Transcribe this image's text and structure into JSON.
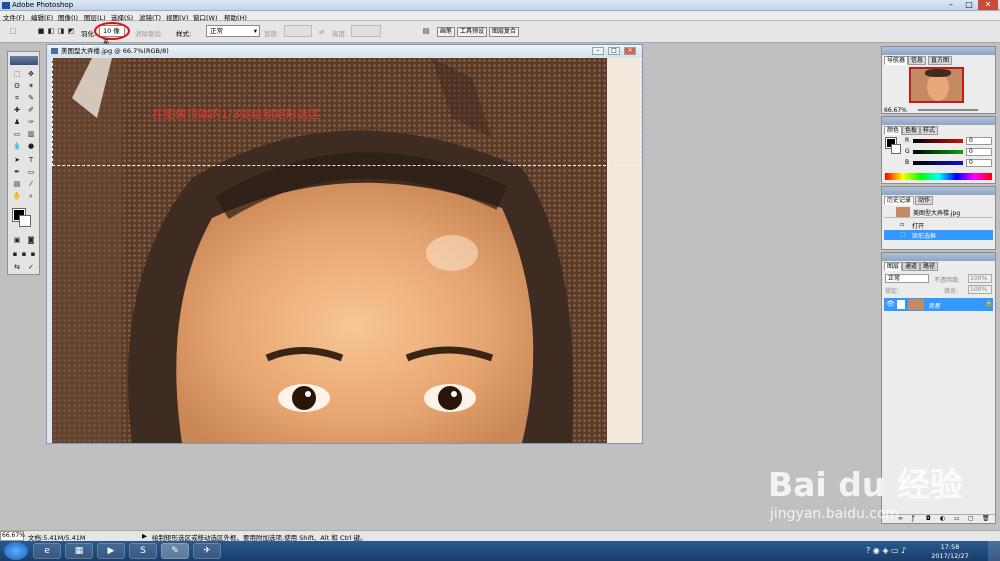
{
  "app": {
    "title": "Adobe Photoshop"
  },
  "menu": [
    "文件(F)",
    "编辑(E)",
    "图像(I)",
    "图层(L)",
    "选择(S)",
    "滤镜(T)",
    "视图(V)",
    "窗口(W)",
    "帮助(H)"
  ],
  "options": {
    "feather_label": "羽化:",
    "feather_value": "10 像素",
    "antialias_label": "消除锯齿",
    "style_label": "样式:",
    "style_value": "正常",
    "width_label": "宽度:",
    "height_label": "高度:"
  },
  "palette_well": [
    "画笔",
    "工具预设",
    "图层复合"
  ],
  "document": {
    "title": "美图型大弄楼.jpg @ 66.7%(RGB/8)",
    "annotation": "在图像顶端的1/3处绘制矩形选区"
  },
  "navigator": {
    "tabs": [
      "导航器",
      "信息",
      "直方图"
    ],
    "zoom": "66.67%"
  },
  "color_panel": {
    "tabs": [
      "颜色",
      "色板",
      "样式"
    ],
    "channels": [
      {
        "label": "R",
        "value": "0",
        "color": "#d01010"
      },
      {
        "label": "G",
        "value": "0",
        "color": "#10a010"
      },
      {
        "label": "B",
        "value": "0",
        "color": "#1010d0"
      }
    ]
  },
  "history_panel": {
    "tabs": [
      "历史记录",
      "动作"
    ],
    "snapshot": "美图型大弄楼.jpg",
    "items": [
      "打开",
      "矩形选框"
    ]
  },
  "layers_panel": {
    "tabs": [
      "图层",
      "通道",
      "路径"
    ],
    "blend_mode": "正常",
    "opacity_label": "不透明度:",
    "opacity_value": "100%",
    "lock_label": "锁定:",
    "fill_label": "填充:",
    "fill_value": "100%",
    "layer_name": "背景"
  },
  "status": {
    "zoom": "66.67%",
    "doc": "文档:5.41M/5.41M",
    "hint": "绘制矩形选区或移动选区外框。要用附加选项,使用 Shift、Alt 和 Ctrl 键。"
  },
  "taskbar": {
    "time": "17:58",
    "date": "2017/12/27"
  },
  "watermark": {
    "brand": "Bai du 经验",
    "url": "jingyan.baidu.com"
  },
  "colors": {
    "accent": "#3399ff",
    "annotation": "#e43a2a",
    "circle": "#e01010"
  }
}
